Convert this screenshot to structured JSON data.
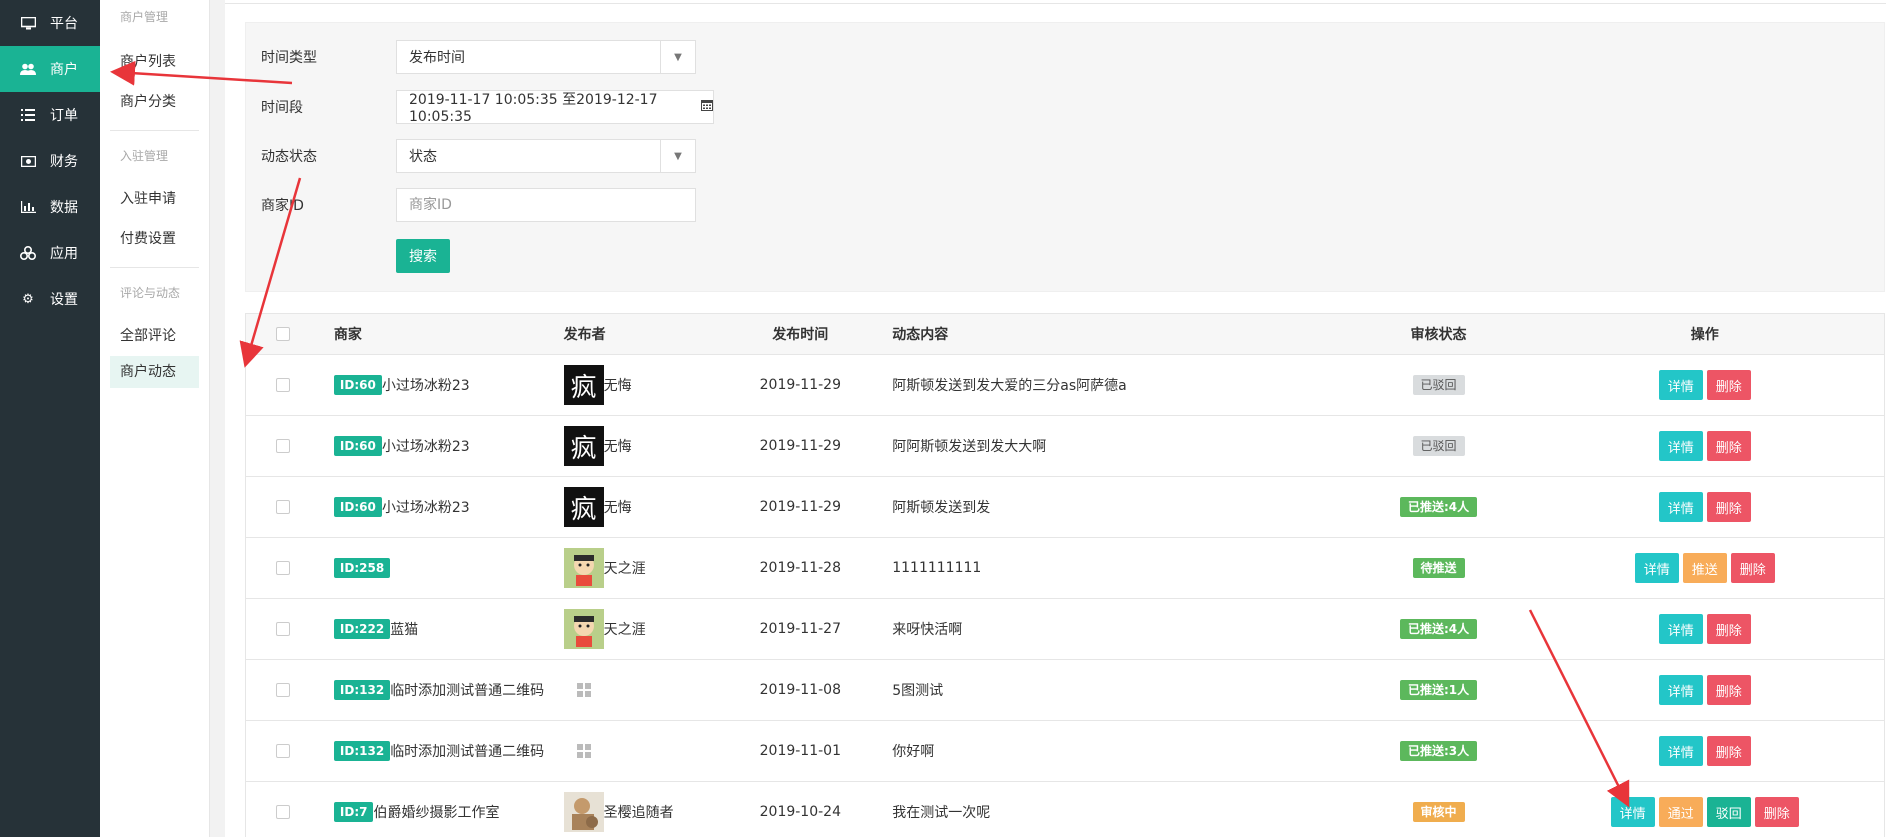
{
  "sidebar": {
    "items": [
      {
        "label": "平台",
        "icon": "monitor-icon"
      },
      {
        "label": "商户",
        "icon": "users-icon",
        "active": true
      },
      {
        "label": "订单",
        "icon": "list-icon"
      },
      {
        "label": "财务",
        "icon": "money-icon"
      },
      {
        "label": "数据",
        "icon": "bar-chart-icon"
      },
      {
        "label": "应用",
        "icon": "cubes-icon"
      },
      {
        "label": "设置",
        "icon": "gear-icon"
      }
    ]
  },
  "submenu": {
    "group1": "商户管理",
    "item_list": "商户列表",
    "item_category": "商户分类",
    "group2": "入驻管理",
    "item_apply": "入驻申请",
    "item_fee": "付费设置",
    "group3": "评论与动态",
    "item_comments": "全部评论",
    "item_dynamics": "商户动态"
  },
  "filter": {
    "time_type_label": "时间类型",
    "time_type_value": "发布时间",
    "period_label": "时间段",
    "period_value": "2019-11-17 10:05:35 至2019-12-17 10:05:35",
    "status_label": "动态状态",
    "status_value": "状态",
    "merchant_id_label": "商家ID",
    "merchant_id_placeholder": "商家ID",
    "search_label": "搜索"
  },
  "table": {
    "headers": {
      "merchant": "商家",
      "publisher": "发布者",
      "time": "发布时间",
      "content": "动态内容",
      "status": "审核状态",
      "ops": "操作"
    },
    "rows": [
      {
        "id": "ID:60",
        "shop": "小过场冰粉23",
        "avatar": "ink",
        "avatar_char": "疯",
        "publisher": "无悔",
        "time": "2019-11-29",
        "content": "阿斯顿发送到发大爱的三分as阿萨德a",
        "status": "已驳回",
        "status_color": "#d9dcde",
        "ops": [
          "详情",
          "删除"
        ]
      },
      {
        "id": "ID:60",
        "shop": "小过场冰粉23",
        "avatar": "ink",
        "avatar_char": "疯",
        "publisher": "无悔",
        "time": "2019-11-29",
        "content": "阿阿斯顿发送到发大大啊",
        "status": "已驳回",
        "status_color": "#d9dcde",
        "ops": [
          "详情",
          "删除"
        ]
      },
      {
        "id": "ID:60",
        "shop": "小过场冰粉23",
        "avatar": "ink",
        "avatar_char": "疯",
        "publisher": "无悔",
        "time": "2019-11-29",
        "content": "阿斯顿发送到发",
        "status": "已推送:4人",
        "status_color": "#5cb85c",
        "ops": [
          "详情",
          "删除"
        ]
      },
      {
        "id": "ID:258",
        "shop": "",
        "avatar": "cartoon",
        "avatar_char": "",
        "publisher": "天之涯",
        "time": "2019-11-28",
        "content": "1111111111",
        "status": "待推送",
        "status_color": "#5cb85c",
        "ops": [
          "详情",
          "推送",
          "删除"
        ]
      },
      {
        "id": "ID:222",
        "shop": "蓝猫",
        "avatar": "cartoon",
        "avatar_char": "",
        "publisher": "天之涯",
        "time": "2019-11-27",
        "content": "来呀快活啊",
        "status": "已推送:4人",
        "status_color": "#5cb85c",
        "ops": [
          "详情",
          "删除"
        ]
      },
      {
        "id": "ID:132",
        "shop": "临时添加测试普通二维码",
        "avatar": "broken",
        "avatar_char": "",
        "publisher": "",
        "time": "2019-11-08",
        "content": "5图测试",
        "status": "已推送:1人",
        "status_color": "#5cb85c",
        "ops": [
          "详情",
          "删除"
        ]
      },
      {
        "id": "ID:132",
        "shop": "临时添加测试普通二维码",
        "avatar": "broken",
        "avatar_char": "",
        "publisher": "",
        "time": "2019-11-01",
        "content": "你好啊",
        "status": "已推送:3人",
        "status_color": "#5cb85c",
        "ops": [
          "详情",
          "删除"
        ]
      },
      {
        "id": "ID:7",
        "shop": "伯爵婚纱摄影工作室",
        "avatar": "photo",
        "avatar_char": "",
        "publisher": "圣樱追随者",
        "time": "2019-10-24",
        "content": "我在测试一次呢",
        "status": "审核中",
        "status_color": "#f0ad4e",
        "ops": [
          "详情",
          "通过",
          "驳回",
          "删除"
        ]
      }
    ]
  },
  "colors": {
    "sidebar_bg": "#263238",
    "accent": "#1ab394",
    "info": "#23c6c8",
    "danger": "#ed5565",
    "warning": "#f8ac59",
    "annotation_arrow": "#e8353a"
  }
}
